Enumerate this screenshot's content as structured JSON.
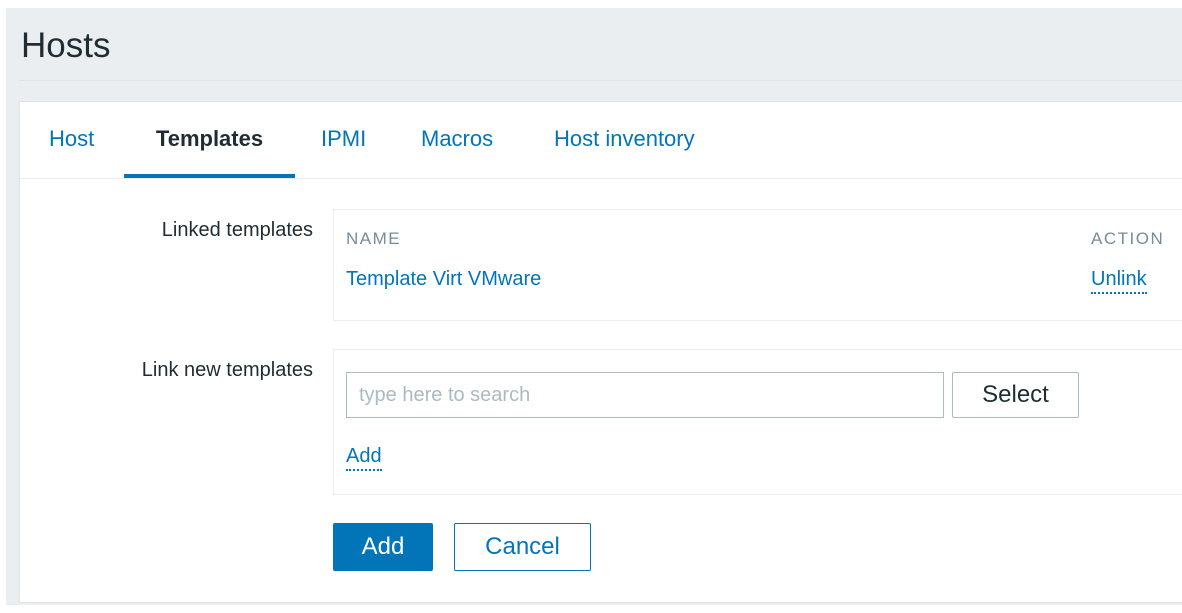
{
  "page": {
    "title": "Hosts"
  },
  "tabs": [
    {
      "label": "Host",
      "active": false
    },
    {
      "label": "Templates",
      "active": true
    },
    {
      "label": "IPMI",
      "active": false
    },
    {
      "label": "Macros",
      "active": false
    },
    {
      "label": "Host inventory",
      "active": false
    }
  ],
  "linked_templates": {
    "label": "Linked templates",
    "columns": {
      "name": "NAME",
      "action": "ACTION"
    },
    "rows": [
      {
        "name": "Template Virt VMware",
        "action": "Unlink"
      }
    ]
  },
  "link_new": {
    "label": "Link new templates",
    "search_placeholder": "type here to search",
    "search_value": "",
    "select_label": "Select",
    "add_link_label": "Add"
  },
  "form_buttons": {
    "add_label": "Add",
    "cancel_label": "Cancel"
  },
  "colors": {
    "accent": "#0275b8",
    "text": "#1f2c33",
    "muted": "#768d99",
    "background": "#ebeef0"
  }
}
